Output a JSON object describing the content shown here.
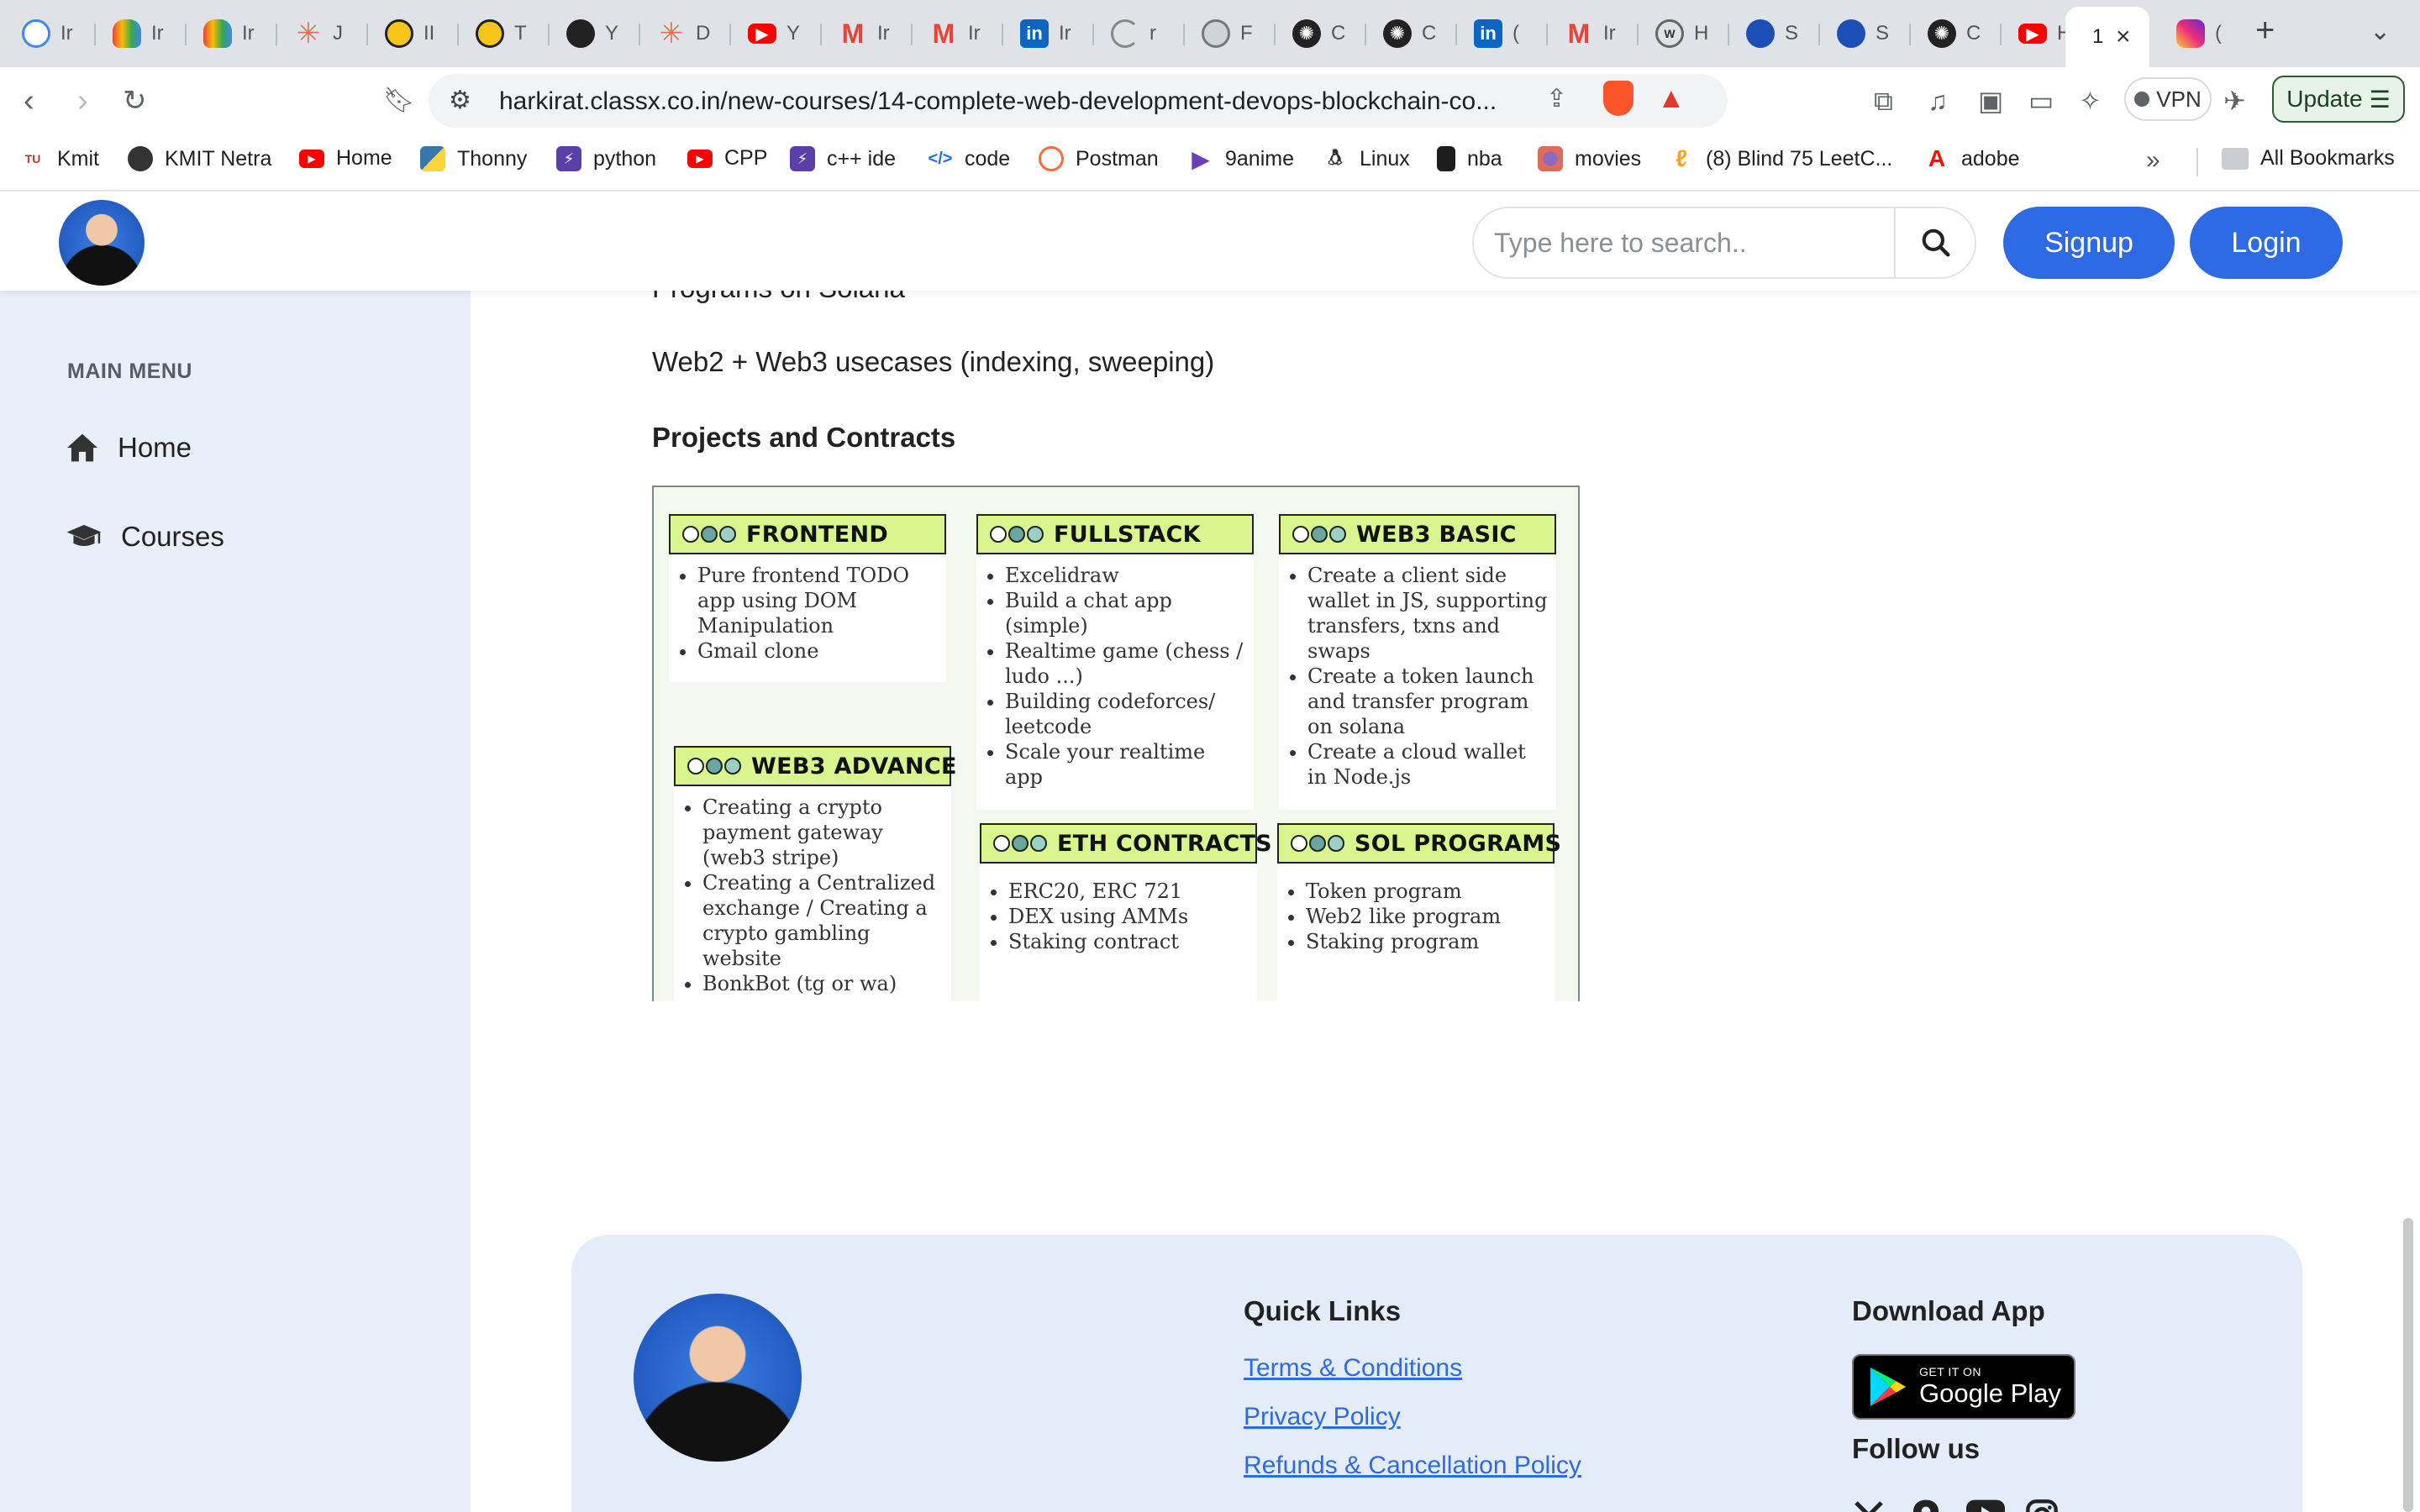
{
  "browser": {
    "tabs": [
      {
        "title": "Ir",
        "icon": "google-icon",
        "color": "#ffffff"
      },
      {
        "title": "Ir",
        "icon": "google-cloud-icon",
        "color": "#ffffff"
      },
      {
        "title": "Ir",
        "icon": "google-cloud-icon",
        "color": "#ffffff"
      },
      {
        "title": "J",
        "icon": "claude-icon",
        "color": "#d97757"
      },
      {
        "title": "II",
        "icon": "imdb-icon",
        "color": "#f5c518"
      },
      {
        "title": "T",
        "icon": "imdb-icon",
        "color": "#f5c518"
      },
      {
        "title": "Y",
        "icon": "github-icon",
        "color": "#222222"
      },
      {
        "title": "D",
        "icon": "claude-icon",
        "color": "#d97757"
      },
      {
        "title": "Y",
        "icon": "youtube-icon",
        "color": "#ff0000"
      },
      {
        "title": "Ir",
        "icon": "gmail-icon",
        "color": "#ea4335"
      },
      {
        "title": "Ir",
        "icon": "gmail-icon",
        "color": "#ea4335"
      },
      {
        "title": "Ir",
        "icon": "linkedin-icon",
        "color": "#0a66c2"
      },
      {
        "title": "r",
        "icon": "loading-icon",
        "color": "#888888"
      },
      {
        "title": "F",
        "icon": "globe-icon",
        "color": "#777777"
      },
      {
        "title": "C",
        "icon": "openai-icon",
        "color": "#222222"
      },
      {
        "title": "C",
        "icon": "openai-icon",
        "color": "#222222"
      },
      {
        "title": "(",
        "icon": "linkedin-icon",
        "color": "#0a66c2"
      },
      {
        "title": "Ir",
        "icon": "gmail-icon",
        "color": "#ea4335"
      },
      {
        "title": "H",
        "icon": "wikipedia-icon",
        "color": "#666666"
      },
      {
        "title": "S",
        "icon": "avatar-icon",
        "color": "#1b4fb5"
      },
      {
        "title": "S",
        "icon": "avatar-icon",
        "color": "#1b4fb5"
      },
      {
        "title": "C",
        "icon": "openai-icon",
        "color": "#222222"
      },
      {
        "title": "H",
        "icon": "youtube-icon",
        "color": "#ff0000"
      },
      {
        "title": "1",
        "icon": "classx-icon",
        "color": "#ffffff",
        "active": true
      },
      {
        "title": "(",
        "icon": "instagram-icon",
        "color": "#d6249f"
      }
    ],
    "new_tab": "+",
    "url": "harkirat.classx.co.in/new-courses/14-complete-web-development-devops-blockchain-co...",
    "vpn_label": "VPN",
    "update_label": "Update",
    "bookmarks": [
      {
        "label": "Kmit",
        "icon": "kmit-icon",
        "color": "#c0392b"
      },
      {
        "label": "KMIT Netra",
        "icon": "globe-icon",
        "color": "#333333"
      },
      {
        "label": "Home",
        "icon": "youtube-icon",
        "color": "#ff0000"
      },
      {
        "label": "Thonny",
        "icon": "python-icon",
        "color": "#3776ab"
      },
      {
        "label": "python",
        "icon": "replit-icon",
        "color": "#5b3fa8"
      },
      {
        "label": "CPP",
        "icon": "youtube-icon",
        "color": "#ff0000"
      },
      {
        "label": "c++ ide",
        "icon": "replit-icon",
        "color": "#5b3fa8"
      },
      {
        "label": "code",
        "icon": "code-icon",
        "color": "#1f6feb"
      },
      {
        "label": "Postman",
        "icon": "postman-icon",
        "color": "#ff6c37"
      },
      {
        "label": "9anime",
        "icon": "play-icon",
        "color": "#6b3fb5"
      },
      {
        "label": "Linux",
        "icon": "linux-icon",
        "color": "#333333"
      },
      {
        "label": "nba",
        "icon": "nba-icon",
        "color": "#1d1d1d"
      },
      {
        "label": "movies",
        "icon": "movies-icon",
        "color": "#8a6bbf"
      },
      {
        "label": "(8) Blind 75 LeetC...",
        "icon": "leetcode-icon",
        "color": "#ffa116"
      },
      {
        "label": "adobe",
        "icon": "adobe-icon",
        "color": "#fa0f00"
      }
    ],
    "all_bookmarks": "All Bookmarks"
  },
  "header": {
    "search_placeholder": "Type here to search..",
    "signup_label": "Signup",
    "login_label": "Login"
  },
  "sidebar": {
    "heading": "MAIN MENU",
    "items": [
      {
        "label": "Home",
        "icon": "home-icon"
      },
      {
        "label": "Courses",
        "icon": "graduation-cap-icon"
      }
    ]
  },
  "content": {
    "prev_line": "Programs on Solana",
    "usecases": "Web2 + Web3 usecases (indexing, sweeping)",
    "projects_heading": "Projects and Contracts",
    "cards": [
      {
        "title": "FRONTEND",
        "items": [
          "Pure frontend TODO app using DOM Manipulation",
          "Gmail clone"
        ]
      },
      {
        "title": "FULLSTACK",
        "items": [
          "Excelidraw",
          "Build a chat app (simple)",
          "Realtime game (chess / ludo ...)",
          "Building codeforces/ leetcode",
          "Scale your realtime app"
        ]
      },
      {
        "title": "WEB3 BASIC",
        "items": [
          "Create a client side wallet in JS, supporting transfers, txns and swaps",
          "Create a token launch and transfer program on solana",
          "Create a cloud wallet in Node.js"
        ]
      },
      {
        "title": "WEB3 ADVANCE",
        "items": [
          "Creating a crypto payment gateway (web3 stripe)",
          "Creating a Centralized exchange / Creating a crypto gambling website",
          "BonkBot (tg or wa)"
        ]
      },
      {
        "title": "ETH CONTRACTS",
        "items": [
          "ERC20, ERC 721",
          "DEX using AMMs",
          "Staking contract"
        ]
      },
      {
        "title": "SOL PROGRAMS",
        "items": [
          "Token program",
          "Web2 like program",
          "Staking program"
        ]
      }
    ]
  },
  "footer": {
    "quick_links_heading": "Quick Links",
    "links": [
      "Terms & Conditions",
      "Privacy Policy",
      "Refunds & Cancellation Policy"
    ],
    "download_heading": "Download App",
    "play_small": "GET IT ON",
    "play_big": "Google Play",
    "follow_heading": "Follow us",
    "socials": [
      "x-icon",
      "location-icon",
      "youtube-icon",
      "instagram-icon"
    ]
  },
  "colors": {
    "accent": "#2d6ae3",
    "sidebar_bg": "#e9eff8",
    "footer_bg": "#e3ecf8",
    "card_head": "#d8f58e"
  }
}
